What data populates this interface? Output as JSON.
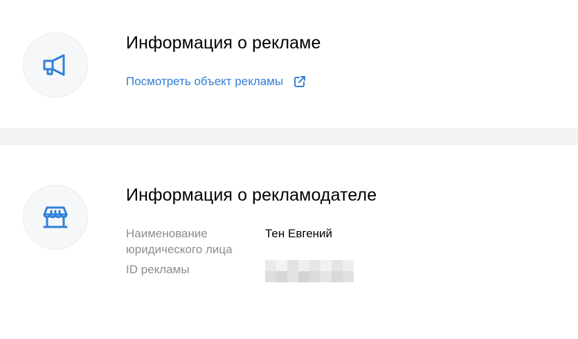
{
  "ad_section": {
    "icon": "megaphone-icon",
    "title": "Информация о рекламе",
    "link_label": "Посмотреть объект рекламы",
    "link_icon": "external-link-icon"
  },
  "advertiser_section": {
    "icon": "storefront-icon",
    "title": "Информация о рекламодателе",
    "rows": [
      {
        "label": "Наименование юридического лица",
        "value": "Тен Евгений"
      },
      {
        "label": "ID рекламы",
        "value": ""
      }
    ]
  },
  "colors": {
    "accent": "#2f7fd6",
    "label_gray": "#8a8d91",
    "divider": "#f2f3f5"
  }
}
